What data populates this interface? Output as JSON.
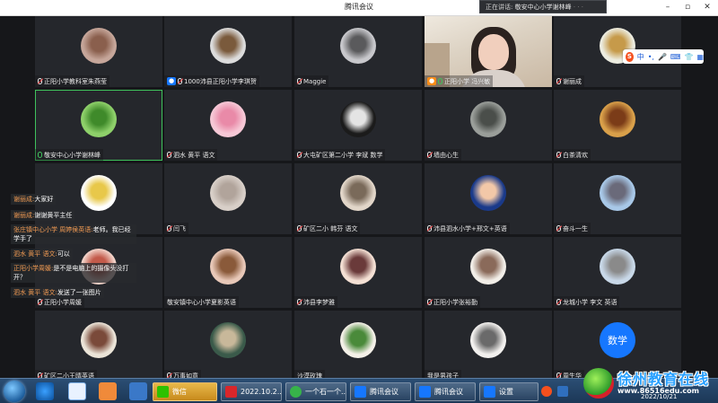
{
  "window": {
    "title": "腾讯会议",
    "controls": [
      "–",
      "▫",
      "✕"
    ]
  },
  "speaking": {
    "label": "正在讲话:",
    "name": "敬安中心小学谢林峰",
    "blurred": "· · ·"
  },
  "ime": {
    "logo": "S",
    "mode": "中",
    "symbols": [
      "•,",
      "🎤",
      "⌨",
      "👕",
      "▦"
    ]
  },
  "tiles": [
    {
      "name": "正阳小学教科室朱燕莹",
      "mic": "off",
      "avatar_colors": [
        "#c6a69a",
        "#8a5f4d"
      ]
    },
    {
      "name": "1000沛县正阳小学李琪贺",
      "mic": "off",
      "host": "blue",
      "avatar_colors": [
        "#dcdcdc",
        "#7a5a3c"
      ]
    },
    {
      "name": "Maggie",
      "mic": "off",
      "avatar_colors": [
        "#c8c8cc",
        "#5a5a5c"
      ]
    },
    {
      "name": "正阳小学 冯兴敏",
      "mic": "on",
      "host": "orange",
      "video": true
    },
    {
      "name": "谢丽成",
      "mic": "off",
      "avatar_colors": [
        "#ecece0",
        "#c69a4a"
      ]
    },
    {
      "name": "敬安中心小学谢林峰",
      "mic": "on",
      "active": true,
      "avatar_colors": [
        "#8ed06a",
        "#3f8a2a"
      ]
    },
    {
      "name": "泗水 黄平 语文",
      "mic": "off",
      "avatar_colors": [
        "#f6c8d6",
        "#e98aa8"
      ]
    },
    {
      "name": "大屯矿区第二小学 李斌 数学",
      "mic": "off",
      "avatar_colors": [
        "#1b1b1b",
        "#e4e4e4"
      ]
    },
    {
      "name": "墙由心生",
      "mic": "off",
      "avatar_colors": [
        "#9a9e9a",
        "#4a4e4a"
      ]
    },
    {
      "name": "白茶清欢",
      "mic": "off",
      "avatar_colors": [
        "#d9a04a",
        "#7b3c18"
      ]
    },
    {
      "name": "",
      "mic": "",
      "avatar_colors": [
        "#ffffff",
        "#e8c84a"
      ]
    },
    {
      "name": "闫飞",
      "mic": "off",
      "avatar_colors": [
        "#d8cfc8",
        "#b1a49b"
      ]
    },
    {
      "name": "矿区二小 韩芬 语文",
      "mic": "off",
      "avatar_colors": [
        "#e2d6c9",
        "#7a6a5a"
      ]
    },
    {
      "name": "沛县泗水小学+邢文+英语",
      "mic": "off",
      "avatar_colors": [
        "#1a3a8a",
        "#f2c8a8"
      ]
    },
    {
      "name": "奋斗一生",
      "mic": "off",
      "avatar_colors": [
        "#a8c8e8",
        "#6a6a7a"
      ]
    },
    {
      "name": "正阳小学周媛",
      "mic": "off",
      "avatar_colors": [
        "#f2d2c8",
        "#c35a4a"
      ]
    },
    {
      "name": "敬安镇中心小学夏影英语",
      "mic": "",
      "avatar_colors": [
        "#e8c8b8",
        "#8a5a3a"
      ]
    },
    {
      "name": "沛县李梦雅",
      "mic": "off",
      "avatar_colors": [
        "#f4e0d4",
        "#6a3a3a"
      ]
    },
    {
      "name": "正阳小学张裕勤",
      "mic": "off",
      "avatar_colors": [
        "#f2eee8",
        "#8a6a5a"
      ]
    },
    {
      "name": "龙城小学 李文 英语",
      "mic": "off",
      "avatar_colors": [
        "#c8d8e8",
        "#8a8a8a"
      ]
    },
    {
      "name": "矿区二小王晴英语",
      "mic": "off",
      "avatar_colors": [
        "#ebe4d8",
        "#7a4a3a"
      ]
    },
    {
      "name": "万事如意",
      "mic": "off",
      "avatar_colors": [
        "#3a5a4a",
        "#c8b89a"
      ]
    },
    {
      "name": "沙漠玫瑰",
      "mic": "",
      "avatar_colors": [
        "#f4f0e8",
        "#4a8a3a"
      ]
    },
    {
      "name": "我是男孩子",
      "mic": "",
      "avatar_colors": [
        "#f2f0ee",
        "#6a6a6a"
      ]
    },
    {
      "name": "周生华",
      "mic": "off",
      "avatar_text": "数学"
    }
  ],
  "chat": [
    {
      "sender": "谢丽成:",
      "text": "大家好"
    },
    {
      "sender": "谢丽成:",
      "text": "谢谢黄平主任"
    },
    {
      "sender": "张庄镇中心小学 周婷侯英语:",
      "text": "老师。我已经学手了"
    },
    {
      "sender": "泗水 黄平 语文:",
      "text": "可以"
    },
    {
      "sender": "正阳小学周媛:",
      "text": "是不是电脑上的摄像头没打开？"
    },
    {
      "sender": "泗水 黄平 语文:",
      "text": "发送了一张图片"
    }
  ],
  "taskbar": {
    "tasks": [
      "微信",
      "2022.10.2...",
      "一个石一个...",
      "腾讯会议",
      "腾讯会议",
      "设置"
    ],
    "clock": "2022/10/21"
  },
  "watermark": {
    "title": "徐州教育在线",
    "url": "www.86516edu.com"
  }
}
